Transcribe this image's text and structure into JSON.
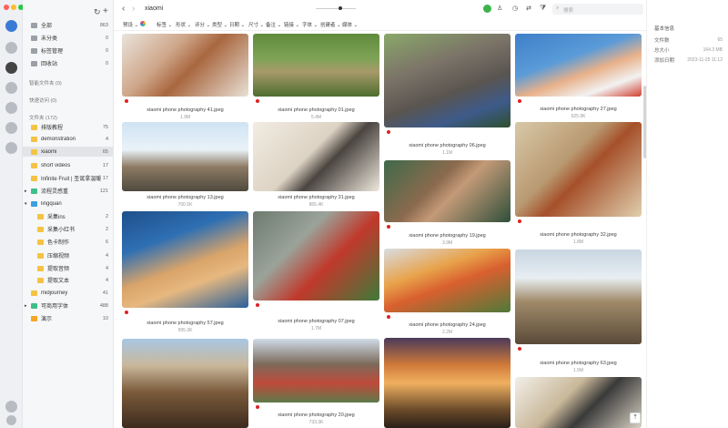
{
  "sidebar": {
    "all": {
      "label": "全部",
      "count": "863"
    },
    "unsorted": {
      "label": "未分类",
      "count": "0"
    },
    "tag_mgmt": {
      "label": "标签管理",
      "count": "0"
    },
    "trash": {
      "label": "回收站",
      "count": "0"
    },
    "smart_folders": "智能文件夹 (0)",
    "quick_access": "快速访问 (0)",
    "folders_title": "文件夹 (172)",
    "folders": [
      {
        "label": "排版教程",
        "count": "75"
      },
      {
        "label": "demonstration",
        "count": "4"
      },
      {
        "label": "xiaomi",
        "count": "65"
      },
      {
        "label": "short videos",
        "count": "17"
      },
      {
        "label": "Infinite Fruit | 圣诞拿温暖",
        "count": "17"
      },
      {
        "label": "流程灵感重",
        "count": "121"
      },
      {
        "label": "lingquan",
        "count": ""
      },
      {
        "label": "采集ins",
        "count": "2"
      },
      {
        "label": "采集小红书",
        "count": "2"
      },
      {
        "label": "色卡制作",
        "count": "6"
      },
      {
        "label": "压缩视频",
        "count": "4"
      },
      {
        "label": "提取音频",
        "count": "4"
      },
      {
        "label": "提取文本",
        "count": "4"
      },
      {
        "label": "midjourney",
        "count": "41"
      },
      {
        "label": "可商用字体",
        "count": "488"
      },
      {
        "label": "演示",
        "count": "10"
      }
    ]
  },
  "topbar": {
    "folder_title": "xiaomi",
    "search_placeholder": "搜索"
  },
  "filters": [
    "预设",
    "标签",
    "形状",
    "评分",
    "类型",
    "日期",
    "尺寸",
    "备注",
    "链接",
    "字体",
    "创建者",
    "媒体"
  ],
  "cards": [
    {
      "name": "xiaomi phone photography 41.jpeg",
      "meta": "1.9M"
    },
    {
      "name": "xiaomi phone photography 01.jpeg",
      "meta": "5.4M"
    },
    {
      "name": "xiaomi phone photography 06.jpeg",
      "meta": "1.1M"
    },
    {
      "name": "xiaomi phone photography 27.jpeg",
      "meta": "925.9K"
    },
    {
      "name": "xiaomi phone photography 13.jpeg",
      "meta": "700.5K"
    },
    {
      "name": "xiaomi phone photography 31.jpeg",
      "meta": "865.4K"
    },
    {
      "name": "xiaomi phone photography 19.jpeg",
      "meta": "3.9M"
    },
    {
      "name": "xiaomi phone photography 32.jpeg",
      "meta": "1.8M"
    },
    {
      "name": "xiaomi phone photography 57.jpeg",
      "meta": "995.3K"
    },
    {
      "name": "xiaomi phone photography 07.jpeg",
      "meta": "1.7M"
    },
    {
      "name": "xiaomi phone photography 24.jpeg",
      "meta": "2.2M"
    },
    {
      "name": "xiaomi phone photography 63.jpeg",
      "meta": "1.5M"
    },
    {
      "name": "xiaomi phone photography 20.jpeg",
      "meta": "733.3K"
    }
  ],
  "info": {
    "title": "基本信息",
    "rows": [
      {
        "label": "文件数",
        "value": "65"
      },
      {
        "label": "总大小",
        "value": "164.3 MB"
      },
      {
        "label": "添加日期",
        "value": "2023-11-25 11:12"
      }
    ]
  },
  "icons": {
    "back": "chevron-left-icon",
    "forward": "chevron-right-icon",
    "sync": "sync-icon",
    "add": "plus-icon",
    "search": "search-icon",
    "filter": "filter-icon"
  }
}
